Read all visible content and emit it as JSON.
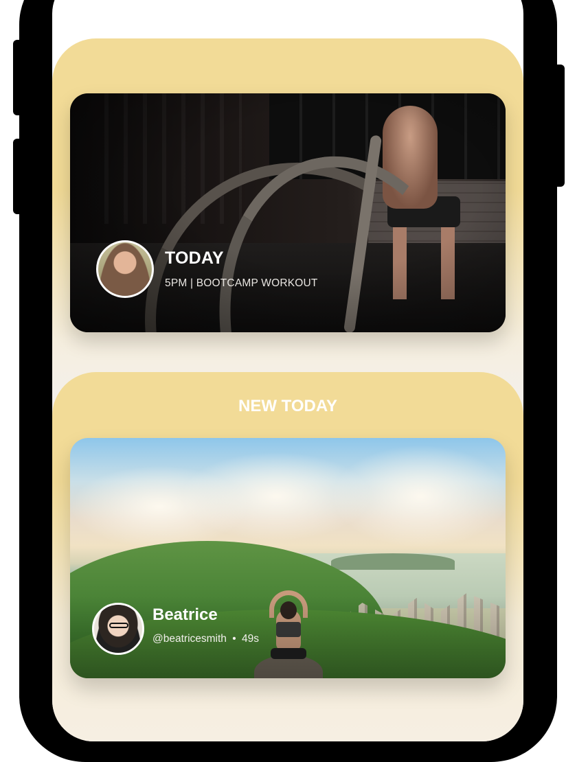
{
  "feature": {
    "title": "TODAY",
    "subtitle": "5PM | BOOTCAMP WORKOUT"
  },
  "new_today": {
    "heading": "NEW TODAY",
    "post": {
      "author_name": "Beatrice",
      "handle": "@beatricesmith",
      "separator": "•",
      "duration": "49s"
    }
  },
  "colors": {
    "card_yellow": "#f2db97",
    "background": "#f3f1f6",
    "text_on_image": "#ffffff"
  }
}
